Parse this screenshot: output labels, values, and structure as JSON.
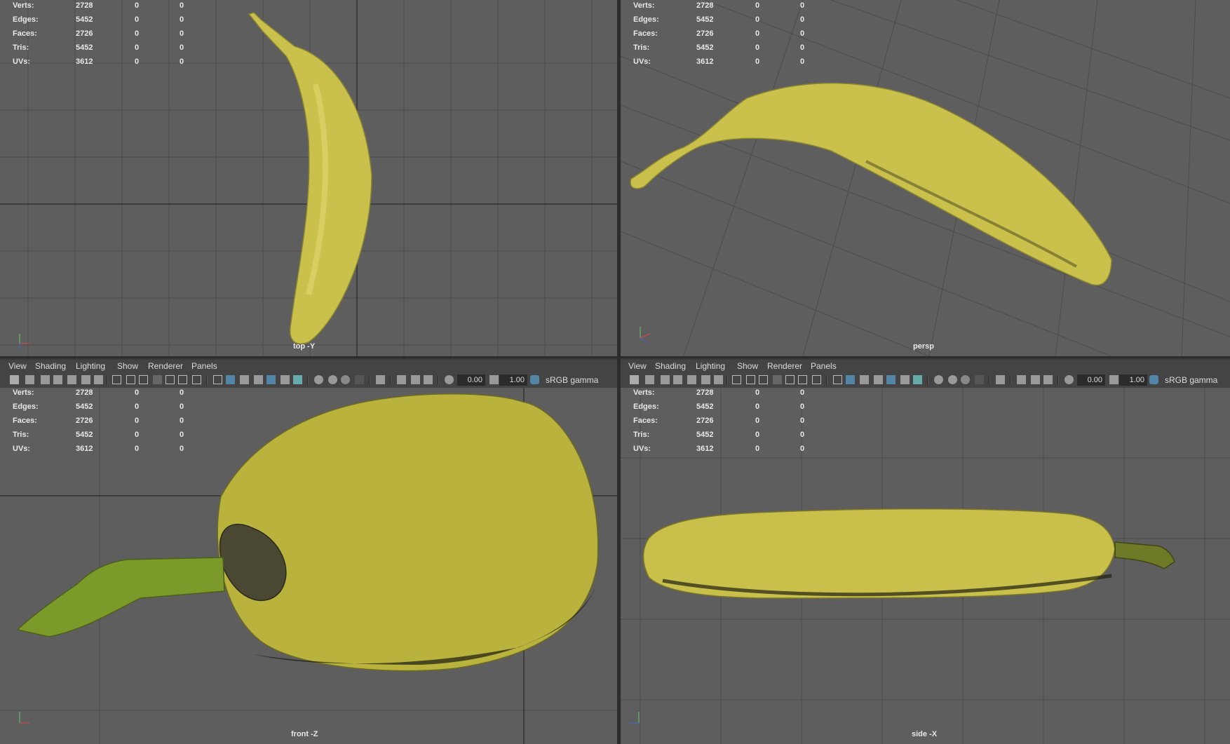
{
  "hud_labels": [
    "Verts:",
    "Edges:",
    "Faces:",
    "Tris:",
    "UVs:"
  ],
  "hud_values": [
    [
      "2728",
      "0",
      "0"
    ],
    [
      "5452",
      "0",
      "0"
    ],
    [
      "2726",
      "0",
      "0"
    ],
    [
      "5452",
      "0",
      "0"
    ],
    [
      "3612",
      "0",
      "0"
    ]
  ],
  "viewports": {
    "top": {
      "camera": "top -Y"
    },
    "persp": {
      "camera": "persp"
    },
    "front": {
      "camera": "front -Z"
    },
    "side": {
      "camera": "side -X"
    }
  },
  "menu": [
    "View",
    "Shading",
    "Lighting",
    "Show",
    "Renderer",
    "Panels"
  ],
  "toolbar": {
    "exposure": "0.00",
    "gamma": "1.00",
    "colorspace": "sRGB gamma"
  },
  "colors": {
    "viewport_bg": "#5e5e5e",
    "grid": "#4a4a4a",
    "panel": "#444444",
    "highlight": "#5285a6",
    "banana": "#c8c24a"
  }
}
